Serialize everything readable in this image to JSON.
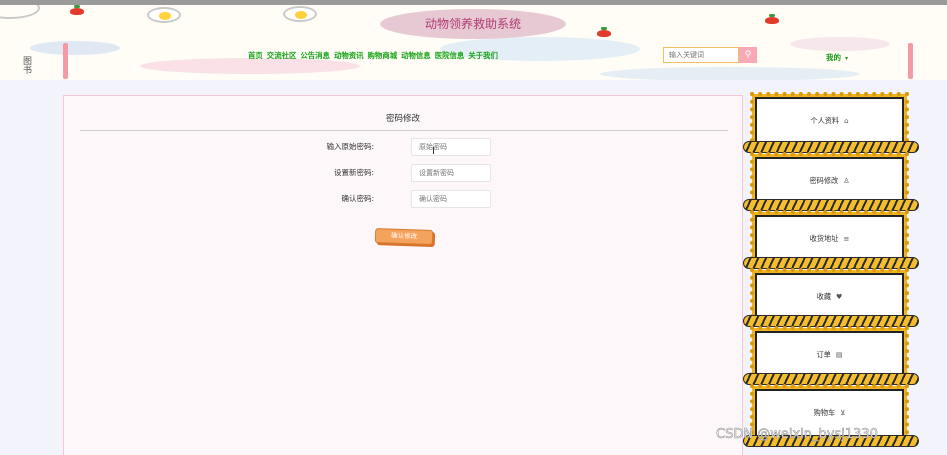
{
  "header": {
    "site_title": "动物领养救助系统",
    "side_text": "图书",
    "nav": [
      "首页",
      "交流社区",
      "公告消息",
      "动物资讯",
      "购物商城",
      "动物信息",
      "医院信息",
      "关于我们"
    ],
    "search_placeholder": "输入关键词",
    "search_icon": "search-icon",
    "my_label": "我的",
    "my_icon": "chevron-down-icon"
  },
  "form": {
    "title": "密码修改",
    "fields": [
      {
        "label": "输入原始密码:",
        "placeholder": "原始密码",
        "value": ""
      },
      {
        "label": "设置新密码:",
        "placeholder": "设置新密码",
        "value": ""
      },
      {
        "label": "确认密码:",
        "placeholder": "确认密码",
        "value": ""
      }
    ],
    "submit_label": "确认修改"
  },
  "menu": {
    "items": [
      {
        "label": "个人资料",
        "icon": "home-icon",
        "glyph": "⌂"
      },
      {
        "label": "密码修改",
        "icon": "user-icon",
        "glyph": "♙"
      },
      {
        "label": "收货地址",
        "icon": "list-icon",
        "glyph": "≡"
      },
      {
        "label": "收藏",
        "icon": "heart-icon",
        "glyph": "♥"
      },
      {
        "label": "订单",
        "icon": "document-icon",
        "glyph": "▤"
      },
      {
        "label": "购物车",
        "icon": "cart-icon",
        "glyph": "⊻"
      }
    ]
  },
  "watermark": "CSDN @weixin_bysj1330",
  "colors": {
    "nav_green": "#18a318",
    "title_pink": "#e6c9d3",
    "button_orange": "#f5a35c",
    "rope_yellow": "#f3bd2e"
  }
}
